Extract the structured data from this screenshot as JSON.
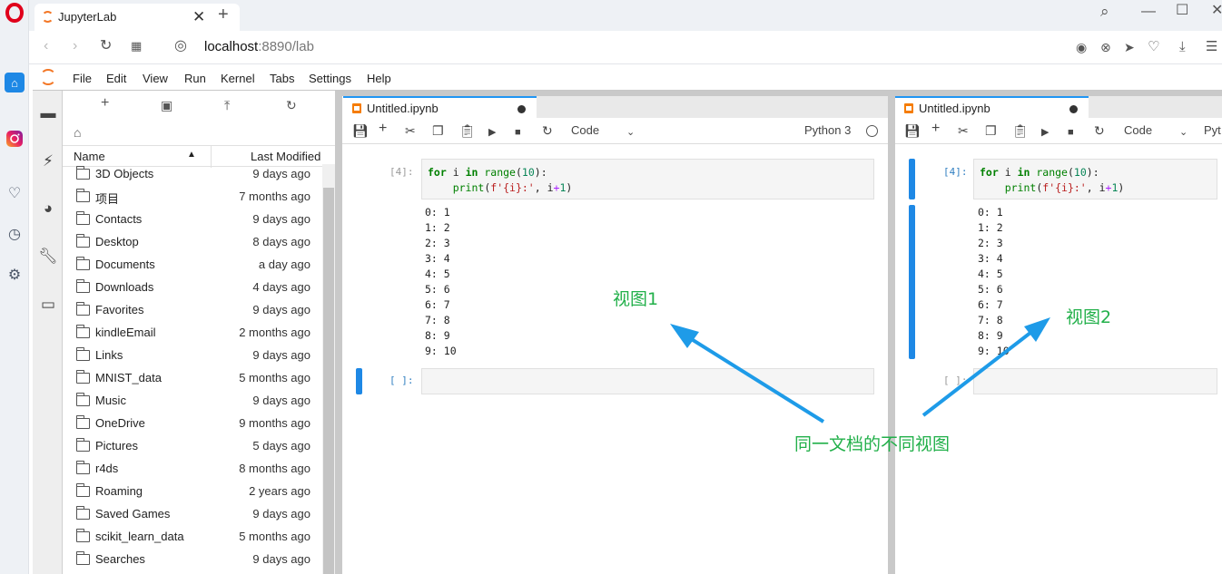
{
  "browser": {
    "tab_title": "JupyterLab",
    "url_host": "localhost",
    "url_rest": ":8890/lab"
  },
  "menu": [
    "File",
    "Edit",
    "View",
    "Run",
    "Kernel",
    "Tabs",
    "Settings",
    "Help"
  ],
  "filebrowser": {
    "col_name": "Name",
    "col_modified": "Last Modified",
    "items": [
      {
        "name": "3D Objects",
        "modified": "9 days ago"
      },
      {
        "name": "项目",
        "modified": "7 months ago"
      },
      {
        "name": "Contacts",
        "modified": "9 days ago"
      },
      {
        "name": "Desktop",
        "modified": "8 days ago"
      },
      {
        "name": "Documents",
        "modified": "a day ago"
      },
      {
        "name": "Downloads",
        "modified": "4 days ago"
      },
      {
        "name": "Favorites",
        "modified": "9 days ago"
      },
      {
        "name": "kindleEmail",
        "modified": "2 months ago"
      },
      {
        "name": "Links",
        "modified": "9 days ago"
      },
      {
        "name": "MNIST_data",
        "modified": "5 months ago"
      },
      {
        "name": "Music",
        "modified": "9 days ago"
      },
      {
        "name": "OneDrive",
        "modified": "9 months ago"
      },
      {
        "name": "Pictures",
        "modified": "5 days ago"
      },
      {
        "name": "r4ds",
        "modified": "8 months ago"
      },
      {
        "name": "Roaming",
        "modified": "2 years ago"
      },
      {
        "name": "Saved Games",
        "modified": "9 days ago"
      },
      {
        "name": "scikit_learn_data",
        "modified": "5 months ago"
      },
      {
        "name": "Searches",
        "modified": "9 days ago"
      }
    ]
  },
  "notebook": {
    "tab_name": "Untitled.ipynb",
    "cell_type": "Code",
    "kernel": "Python 3",
    "kernel_short": "Pyt",
    "prompt_done": "[4]:",
    "prompt_empty": "[ ]:",
    "output": [
      "0: 1",
      "1: 2",
      "2: 3",
      "3: 4",
      "4: 5",
      "5: 6",
      "6: 7",
      "7: 8",
      "8: 9",
      "9: 10"
    ]
  },
  "annotations": {
    "view1": "视图1",
    "view2": "视图2",
    "caption": "同一文档的不同视图",
    "arrow_color": "#1e9be8",
    "text_color": "#22b04a"
  }
}
